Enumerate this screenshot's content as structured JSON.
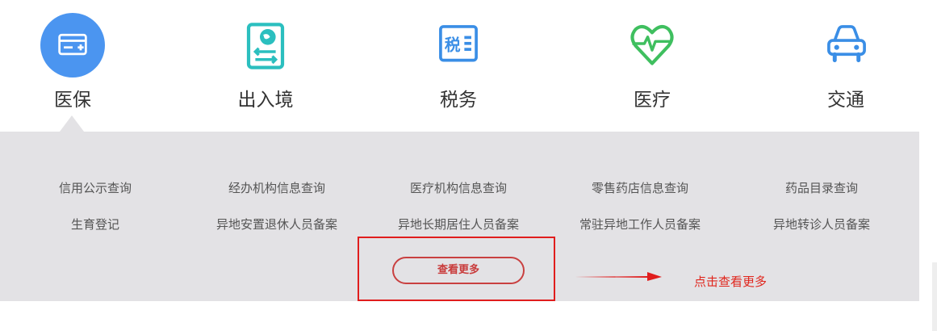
{
  "categories": [
    {
      "label": "医保",
      "icon": "medical-card-icon",
      "active": true
    },
    {
      "label": "出入境",
      "icon": "passport-exchange-icon",
      "active": false
    },
    {
      "label": "税务",
      "icon": "tax-icon",
      "active": false
    },
    {
      "label": "医疗",
      "icon": "heart-pulse-icon",
      "active": false
    },
    {
      "label": "交通",
      "icon": "car-icon",
      "active": false
    }
  ],
  "services": {
    "row1": [
      "信用公示查询",
      "经办机构信息查询",
      "医疗机构信息查询",
      "零售药店信息查询",
      "药品目录查询"
    ],
    "row2": [
      "生育登记",
      "异地安置退休人员备案",
      "异地长期居住人员备案",
      "常驻异地工作人员备案",
      "异地转诊人员备案"
    ]
  },
  "more_button": "查看更多",
  "annotation": "点击查看更多",
  "colors": {
    "active_circle": "#4b95f0",
    "teal_icon": "#2bbfbf",
    "blue_icon": "#3a8ee6",
    "green_icon": "#3fbf5f",
    "panel_bg": "#e3e2e5",
    "highlight_red": "#e01d1d"
  }
}
